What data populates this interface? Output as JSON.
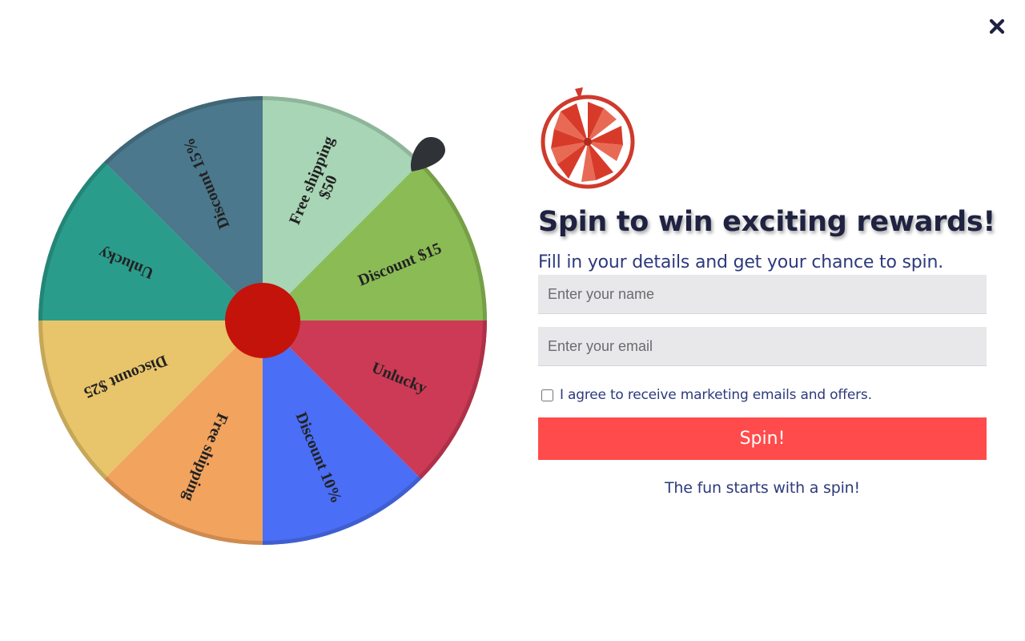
{
  "wheel": {
    "segments": [
      {
        "label": "Free shipping\n$50",
        "color": "#a8d5b5"
      },
      {
        "label": "Discount $15",
        "color": "#8bbb55"
      },
      {
        "label": "Unlucky",
        "color": "#cc3a55"
      },
      {
        "label": "Discount 10%",
        "color": "#4a6ef5"
      },
      {
        "label": "Free shipping",
        "color": "#f2a35e"
      },
      {
        "label": "Discount $25",
        "color": "#e8c46a"
      },
      {
        "label": "Unlucky",
        "color": "#2a9c8c"
      },
      {
        "label": "Discount 15%",
        "color": "#4b788c"
      }
    ],
    "hub_color": "#c4130a",
    "pointer_color": "#2f3338"
  },
  "panel": {
    "title": "Spin to win exciting rewards!",
    "subtitle": "Fill in your details and get your chance to spin.",
    "name_placeholder": "Enter your name",
    "email_placeholder": "Enter your email",
    "consent_label": "I agree to receive marketing emails and offers.",
    "spin_label": "Spin!",
    "tagline": "The fun starts with a spin!"
  },
  "colors": {
    "accent": "#ff4b4b",
    "heading": "#1f2240",
    "text": "#2d3a7c"
  }
}
